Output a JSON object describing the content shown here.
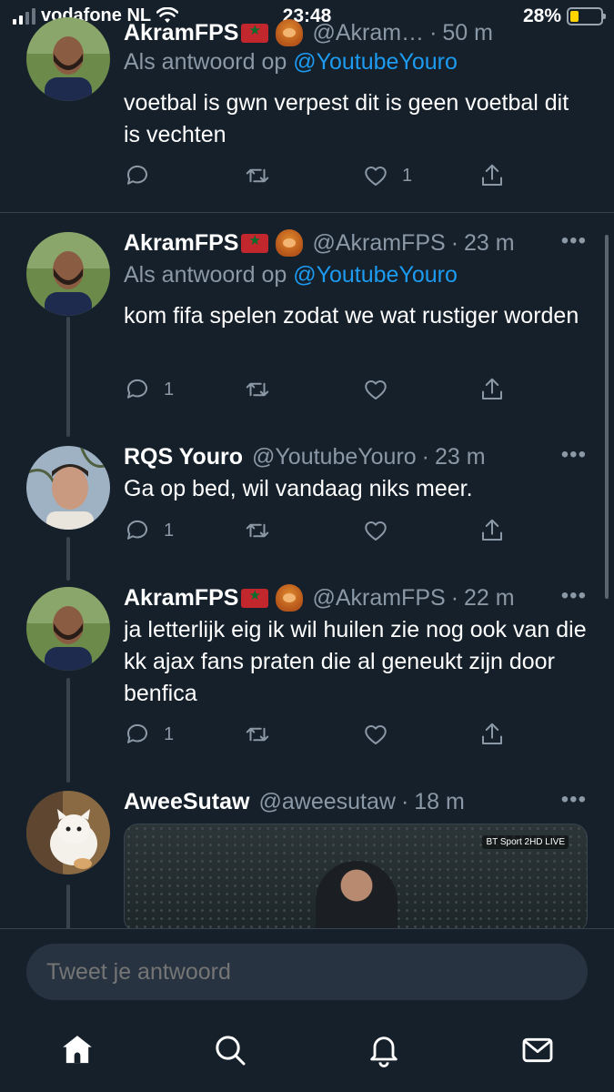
{
  "status_bar": {
    "carrier": "vodafone NL",
    "time": "23:48",
    "battery": "28%",
    "battery_level": 0.28
  },
  "tweets": [
    {
      "name": "AkramFPS",
      "handle": "@Akram…",
      "time": "50 m",
      "reply_prefix": "Als antwoord op",
      "reply_handle": "@YoutubeYouro",
      "text": "voetbal is gwn verpest dit is geen voetbal dit is vechten",
      "replies": "",
      "likes": "1"
    },
    {
      "name": "AkramFPS",
      "handle": "@AkramFPS",
      "time": "23 m",
      "reply_prefix": "Als antwoord op",
      "reply_handle": "@YoutubeYouro",
      "text": "kom fifa spelen zodat we wat rustiger worden",
      "replies": "1",
      "likes": ""
    },
    {
      "name": "RQS Youro",
      "handle": "@YoutubeYouro",
      "time": "23 m",
      "text": "Ga op bed, wil vandaag niks meer.",
      "replies": "1",
      "likes": ""
    },
    {
      "name": "AkramFPS",
      "handle": "@AkramFPS",
      "time": "22 m",
      "text": "ja letterlijk eig ik wil huilen zie nog ook van die kk ajax fans praten die al geneukt zijn door benfica",
      "replies": "1",
      "likes": ""
    },
    {
      "name": "AweeSutaw",
      "handle": "@aweesutaw",
      "time": "18 m",
      "media_badge": "BT Sport 2HD LIVE"
    }
  ],
  "separator": "·",
  "more": "•••",
  "reply_box": {
    "placeholder": "Tweet je antwoord"
  },
  "icons": {
    "reply": "reply-icon",
    "retweet": "retweet-icon",
    "like": "heart-icon",
    "share": "share-icon",
    "home": "home-icon",
    "search": "search-icon",
    "notifications": "bell-icon",
    "messages": "mail-icon"
  },
  "colors": {
    "background": "#15202b",
    "link": "#1d9bf0",
    "secondary": "#8b98a5",
    "battery": "#ffd400"
  }
}
